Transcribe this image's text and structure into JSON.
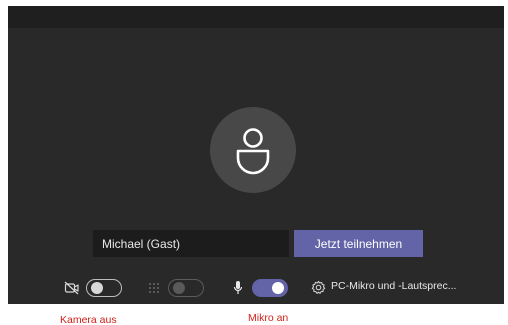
{
  "prejoin": {
    "name_value": "Michael (Gast)",
    "join_label": "Jetzt teilnehmen",
    "camera": {
      "icon": "camera-off-icon",
      "state": "off"
    },
    "background_effects": {
      "icon": "background-blur-icon",
      "state": "disabled"
    },
    "microphone": {
      "icon": "microphone-icon",
      "state": "on"
    },
    "audio_device": {
      "icon": "gear-icon",
      "label": "PC-Mikro und -Lautsprec..."
    }
  },
  "annotations": {
    "camera": "Kamera aus",
    "mic": "Mikro an"
  },
  "colors": {
    "stage": "#292929",
    "accent": "#6264a7",
    "annotation": "#d0211b"
  }
}
